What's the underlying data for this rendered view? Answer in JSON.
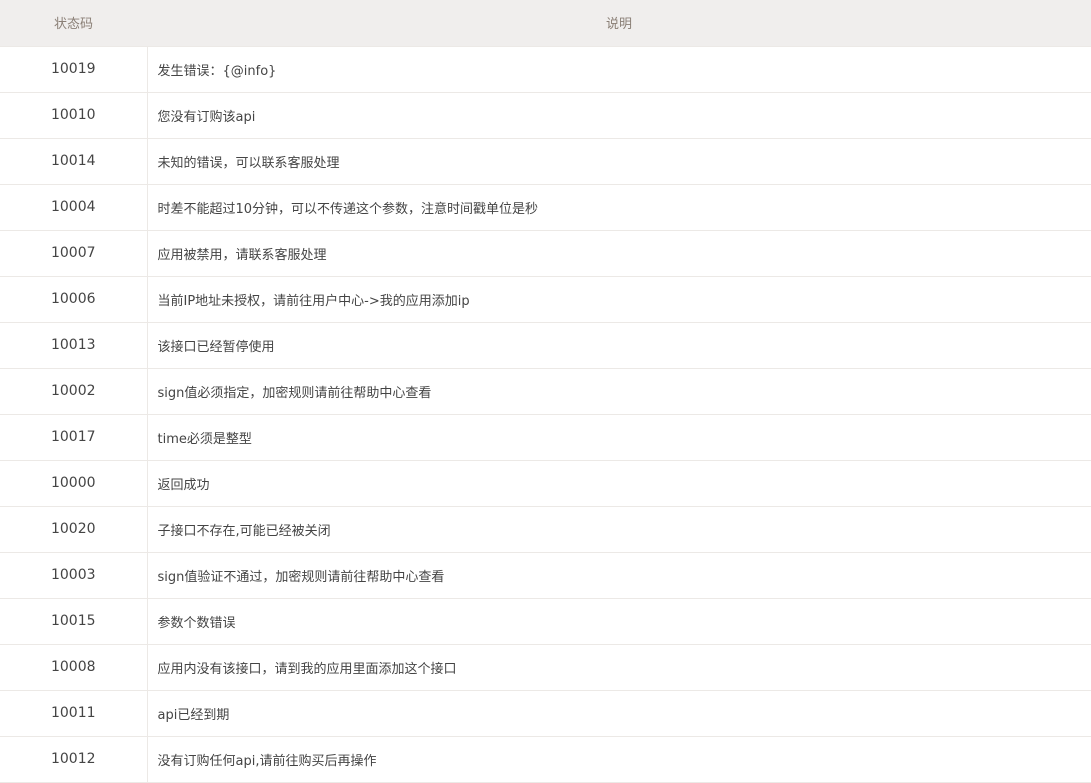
{
  "header": {
    "code": "状态码",
    "desc": "说明"
  },
  "rows": [
    {
      "code": "10019",
      "desc": "发生错误：{@info}"
    },
    {
      "code": "10010",
      "desc": "您没有订购该api"
    },
    {
      "code": "10014",
      "desc": "未知的错误，可以联系客服处理"
    },
    {
      "code": "10004",
      "desc": "时差不能超过10分钟，可以不传递这个参数，注意时间戳单位是秒"
    },
    {
      "code": "10007",
      "desc": "应用被禁用，请联系客服处理"
    },
    {
      "code": "10006",
      "desc": "当前IP地址未授权，请前往用户中心->我的应用添加ip"
    },
    {
      "code": "10013",
      "desc": "该接口已经暂停使用"
    },
    {
      "code": "10002",
      "desc": "sign值必须指定，加密规则请前往帮助中心查看"
    },
    {
      "code": "10017",
      "desc": "time必须是整型"
    },
    {
      "code": "10000",
      "desc": "返回成功"
    },
    {
      "code": "10020",
      "desc": "子接口不存在,可能已经被关闭"
    },
    {
      "code": "10003",
      "desc": "sign值验证不通过，加密规则请前往帮助中心查看"
    },
    {
      "code": "10015",
      "desc": "参数个数错误"
    },
    {
      "code": "10008",
      "desc": "应用内没有该接口，请到我的应用里面添加这个接口"
    },
    {
      "code": "10011",
      "desc": "api已经到期"
    },
    {
      "code": "10012",
      "desc": "没有订购任何api,请前往购买后再操作"
    }
  ]
}
